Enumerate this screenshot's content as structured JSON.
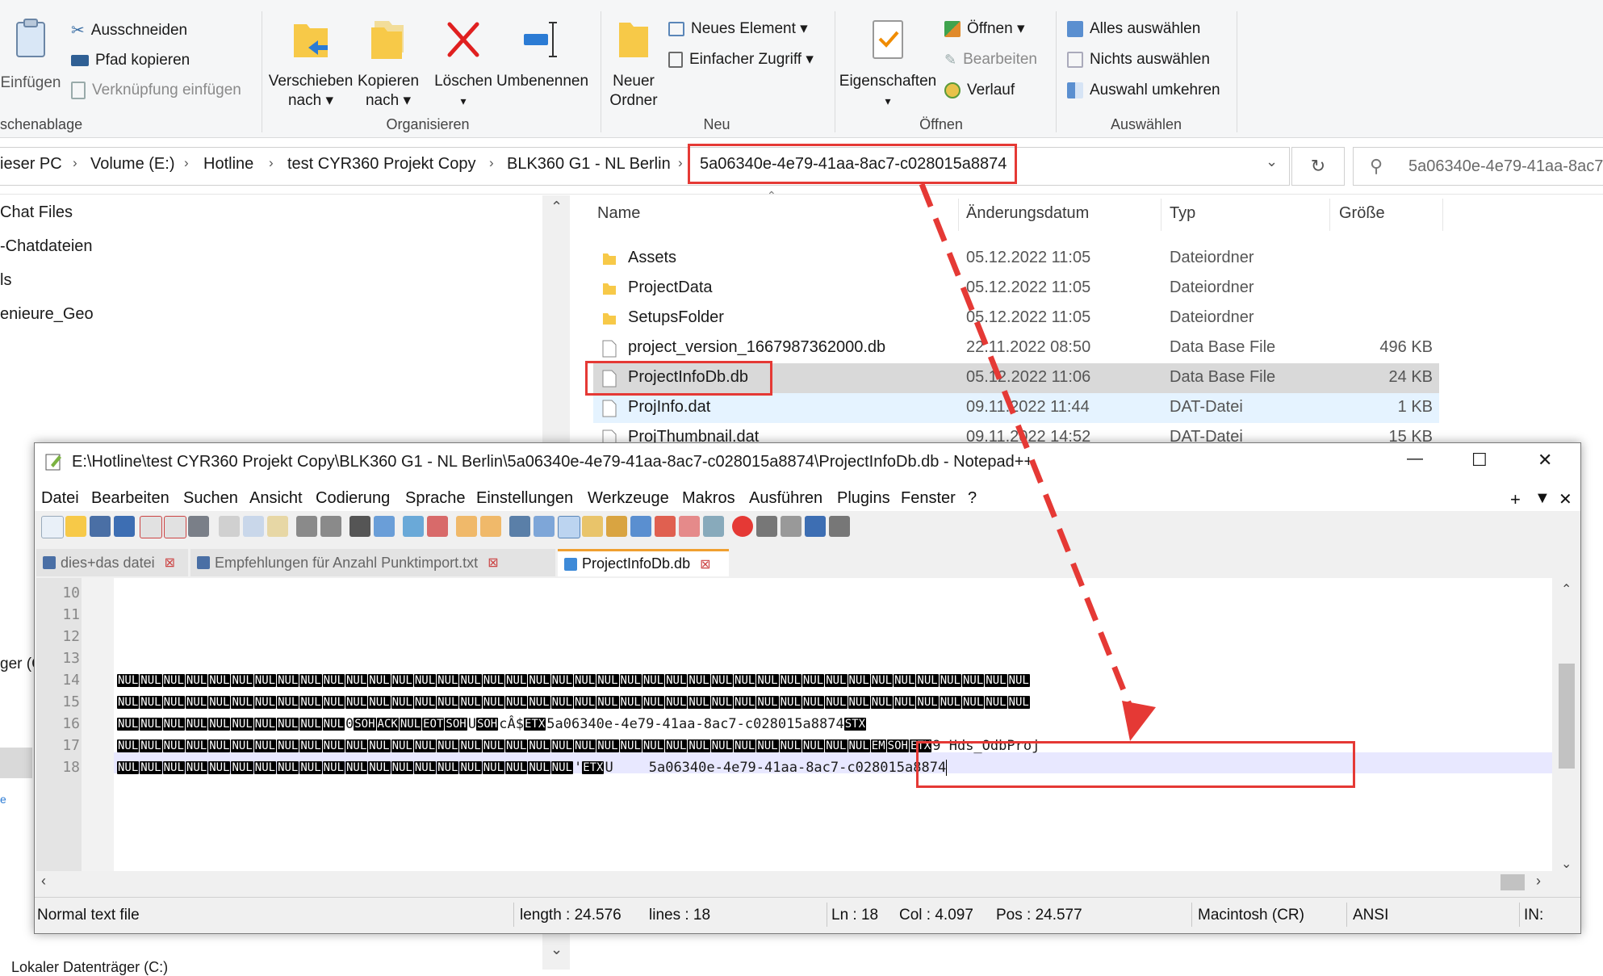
{
  "ribbon": {
    "clipboard": {
      "paste": "Einfügen",
      "cut": "Ausschneiden",
      "copy_path": "Pfad kopieren",
      "paste_shortcut": "Verknüpfung einfügen",
      "group": "schenablage"
    },
    "organize": {
      "move_to_1": "Verschieben",
      "move_to_2": "nach ▾",
      "copy_to_1": "Kopieren",
      "copy_to_2": "nach ▾",
      "delete": "Löschen",
      "delete_arrow": "▾",
      "rename": "Umbenennen",
      "group": "Organisieren"
    },
    "new": {
      "new_folder_1": "Neuer",
      "new_folder_2": "Ordner",
      "new_item": "Neues Element ▾",
      "easy_access": "Einfacher Zugriff ▾",
      "group": "Neu"
    },
    "open": {
      "properties": "Eigenschaften",
      "properties_arrow": "▾",
      "open": "Öffnen ▾",
      "edit": "Bearbeiten",
      "history": "Verlauf",
      "group": "Öffnen"
    },
    "select": {
      "select_all": "Alles auswählen",
      "select_none": "Nichts auswählen",
      "invert": "Auswahl umkehren",
      "group": "Auswählen"
    }
  },
  "address": {
    "crumbs": [
      "ieser PC",
      "Volume (E:)",
      "Hotline",
      "test CYR360 Projekt Copy",
      "BLK360 G1 - NL Berlin",
      "5a06340e-4e79-41aa-8ac7-c028015a8874"
    ],
    "search_value": "5a06340e-4e79-41aa-8ac7"
  },
  "nav": {
    "items": [
      "Chat Files",
      "-Chatdateien",
      "ls",
      "enieure_Geo",
      "ger (C",
      "e",
      "Lokaler Datenträger (C:)"
    ]
  },
  "files": {
    "headers": {
      "name": "Name",
      "date": "Änderungsdatum",
      "type": "Typ",
      "size": "Größe"
    },
    "rows": [
      {
        "name": "Assets",
        "date": "05.12.2022 11:05",
        "type": "Dateiordner",
        "size": ""
      },
      {
        "name": "ProjectData",
        "date": "05.12.2022 11:05",
        "type": "Dateiordner",
        "size": ""
      },
      {
        "name": "SetupsFolder",
        "date": "05.12.2022 11:05",
        "type": "Dateiordner",
        "size": ""
      },
      {
        "name": "project_version_1667987362000.db",
        "date": "22.11.2022 08:50",
        "type": "Data Base File",
        "size": "496 KB"
      },
      {
        "name": "ProjectInfoDb.db",
        "date": "05.12.2022 11:06",
        "type": "Data Base File",
        "size": "24 KB"
      },
      {
        "name": "ProjInfo.dat",
        "date": "09.11.2022 11:44",
        "type": "DAT-Datei",
        "size": "1 KB"
      },
      {
        "name": "ProjThumbnail.dat",
        "date": "09.11.2022 14:52",
        "type": "DAT-Datei",
        "size": "15 KB"
      }
    ]
  },
  "notepad": {
    "title": "E:\\Hotline\\test CYR360 Projekt Copy\\BLK360 G1 - NL Berlin\\5a06340e-4e79-41aa-8ac7-c028015a8874\\ProjectInfoDb.db - Notepad++",
    "win_min": "—",
    "win_max": "☐",
    "win_close": "✕",
    "menu": [
      "Datei",
      "Bearbeiten",
      "Suchen",
      "Ansicht",
      "Codierung",
      "Sprache",
      "Einstellungen",
      "Werkzeuge",
      "Makros",
      "Ausführen",
      "Plugins",
      "Fenster",
      "?"
    ],
    "menu_right": {
      "plus": "+",
      "down": "▼",
      "close": "✕"
    },
    "tabs": [
      "dies+das datei",
      "Empfehlungen für Anzahl Punktimport.txt",
      "ProjectInfoDb.db"
    ],
    "line_numbers": [
      "10",
      "11",
      "12",
      "13",
      "14",
      "15",
      "16",
      "17",
      "18"
    ],
    "ctl": {
      "nul": "NUL",
      "soh": "SOH",
      "ack": "ACK",
      "eot": "EOT",
      "etx": "ETX",
      "stx": "STX",
      "em": "EM"
    },
    "line16": {
      "t0": "0",
      "t1": "U",
      "t2": "cÂ$",
      "t3": "5a06340e-4e79-41aa-8ac7-c028015a8874"
    },
    "line17": {
      "t1": "9 Hds_OdbProj"
    },
    "line18": {
      "t1": "'",
      "t2": "U",
      "t3": "5a06340e-4e79-41aa-8ac7-c028015a8874"
    },
    "status": {
      "type": "Normal text file",
      "length": "length : 24.576",
      "lines": "lines : 18",
      "ln": "Ln : 18",
      "col": "Col : 4.097",
      "pos": "Pos : 24.577",
      "eol": "Macintosh (CR)",
      "enc": "ANSI",
      "ins": "IN:"
    }
  },
  "colors": {
    "highlight": "#e53935",
    "selected_row": "#d9d9d9",
    "hover_row": "#e5f3ff"
  }
}
